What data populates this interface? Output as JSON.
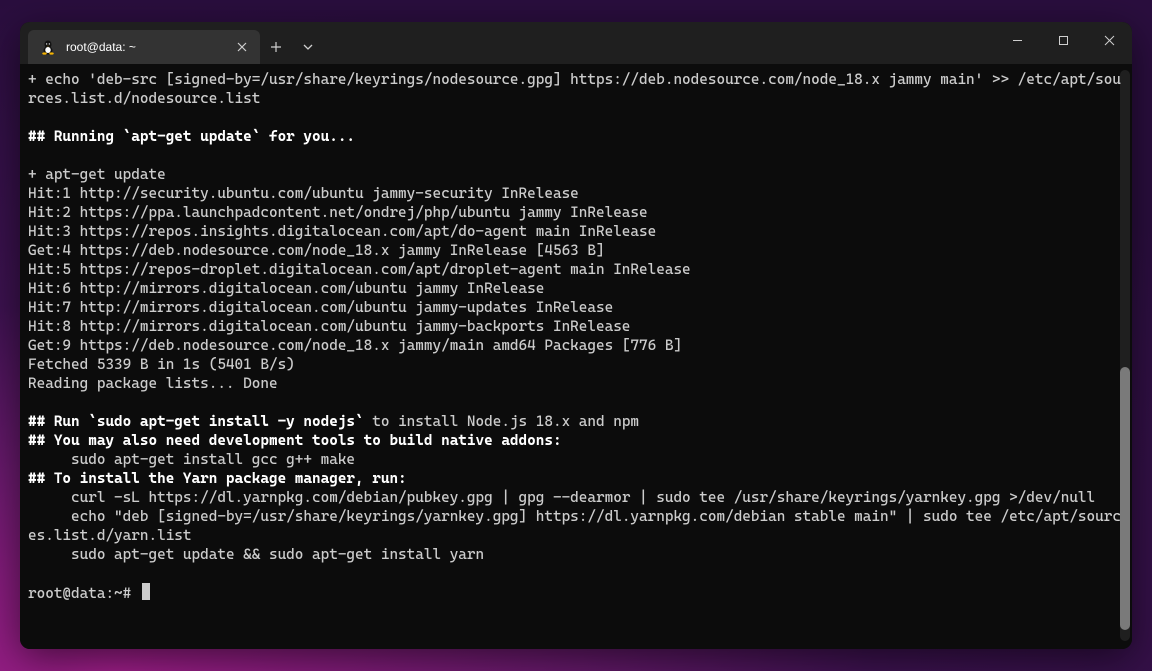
{
  "tab": {
    "title": "root@data: ~"
  },
  "accelerators": {
    "newtab": "+",
    "tabmenu": "⌄",
    "close": "✕"
  },
  "terminal": {
    "lines": [
      {
        "t": "plain",
        "text": "+ echo 'deb-src [signed-by=/usr/share/keyrings/nodesource.gpg] https://deb.nodesource.com/node_18.x jammy main' >> /etc/apt/sources.list.d/nodesource.list"
      },
      {
        "t": "blank"
      },
      {
        "t": "bold",
        "text": "## Running `apt-get update` for you..."
      },
      {
        "t": "blank"
      },
      {
        "t": "plain",
        "text": "+ apt-get update"
      },
      {
        "t": "plain",
        "text": "Hit:1 http://security.ubuntu.com/ubuntu jammy-security InRelease"
      },
      {
        "t": "plain",
        "text": "Hit:2 https://ppa.launchpadcontent.net/ondrej/php/ubuntu jammy InRelease"
      },
      {
        "t": "plain",
        "text": "Hit:3 https://repos.insights.digitalocean.com/apt/do-agent main InRelease"
      },
      {
        "t": "plain",
        "text": "Get:4 https://deb.nodesource.com/node_18.x jammy InRelease [4563 B]"
      },
      {
        "t": "plain",
        "text": "Hit:5 https://repos-droplet.digitalocean.com/apt/droplet-agent main InRelease"
      },
      {
        "t": "plain",
        "text": "Hit:6 http://mirrors.digitalocean.com/ubuntu jammy InRelease"
      },
      {
        "t": "plain",
        "text": "Hit:7 http://mirrors.digitalocean.com/ubuntu jammy-updates InRelease"
      },
      {
        "t": "plain",
        "text": "Hit:8 http://mirrors.digitalocean.com/ubuntu jammy-backports InRelease"
      },
      {
        "t": "plain",
        "text": "Get:9 https://deb.nodesource.com/node_18.x jammy/main amd64 Packages [776 B]"
      },
      {
        "t": "plain",
        "text": "Fetched 5339 B in 1s (5401 B/s)"
      },
      {
        "t": "plain",
        "text": "Reading package lists... Done"
      },
      {
        "t": "blank"
      },
      {
        "t": "mixed",
        "parts": [
          {
            "bold": true,
            "text": "## Run `sudo apt-get install -y nodejs`"
          },
          {
            "bold": false,
            "text": " to install Node.js 18.x and npm"
          }
        ]
      },
      {
        "t": "bold",
        "text": "## You may also need development tools to build native addons:"
      },
      {
        "t": "plain",
        "text": "     sudo apt-get install gcc g++ make"
      },
      {
        "t": "bold",
        "text": "## To install the Yarn package manager, run:"
      },
      {
        "t": "plain",
        "text": "     curl -sL https://dl.yarnpkg.com/debian/pubkey.gpg | gpg --dearmor | sudo tee /usr/share/keyrings/yarnkey.gpg >/dev/null"
      },
      {
        "t": "plain",
        "text": "     echo \"deb [signed-by=/usr/share/keyrings/yarnkey.gpg] https://dl.yarnpkg.com/debian stable main\" | sudo tee /etc/apt/sources.list.d/yarn.list"
      },
      {
        "t": "plain",
        "text": "     sudo apt-get update && sudo apt-get install yarn"
      }
    ],
    "prompt": "root@data:~# "
  }
}
